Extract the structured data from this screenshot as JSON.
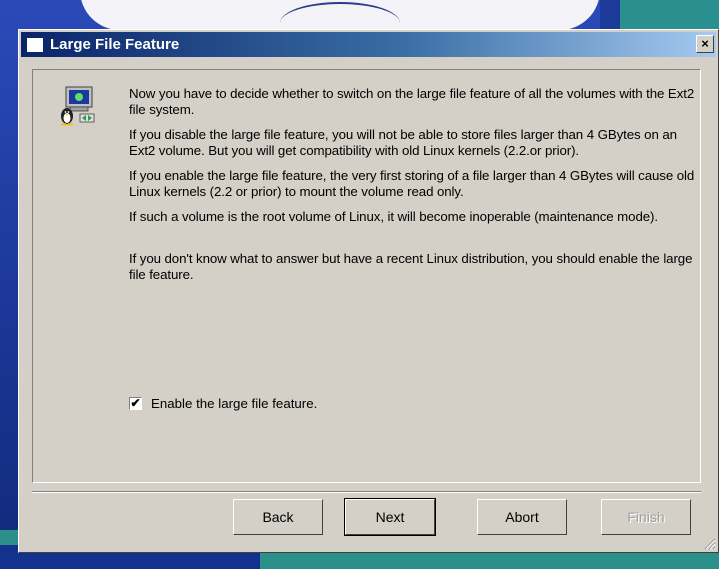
{
  "window": {
    "title": "Large File Feature",
    "close_label": "×"
  },
  "content": {
    "paragraphs": [
      "Now you have to decide whether to switch on the large file feature of all the volumes with the Ext2 file system.",
      "If you disable the large file feature, you will not be able to store files larger than 4 GBytes on an Ext2 volume. But you will get compatibility with old Linux kernels (2.2.or prior).",
      "If you enable the large file feature, the very first storing of a file larger than 4 GBytes will cause old Linux kernels (2.2 or prior) to mount the volume read only.",
      "If such a volume is the root volume of Linux, it will become inoperable (maintenance mode).",
      "If you don't know what to answer but have a recent Linux distribution, you should enable the large file feature."
    ],
    "checkbox": {
      "label": "Enable the large file feature.",
      "checked": true,
      "mark": "✔"
    }
  },
  "buttons": {
    "back": "Back",
    "next": "Next",
    "abort": "Abort",
    "finish": "Finish"
  },
  "icons": {
    "title": "window-icon",
    "main": "penguin-computer-icon"
  }
}
